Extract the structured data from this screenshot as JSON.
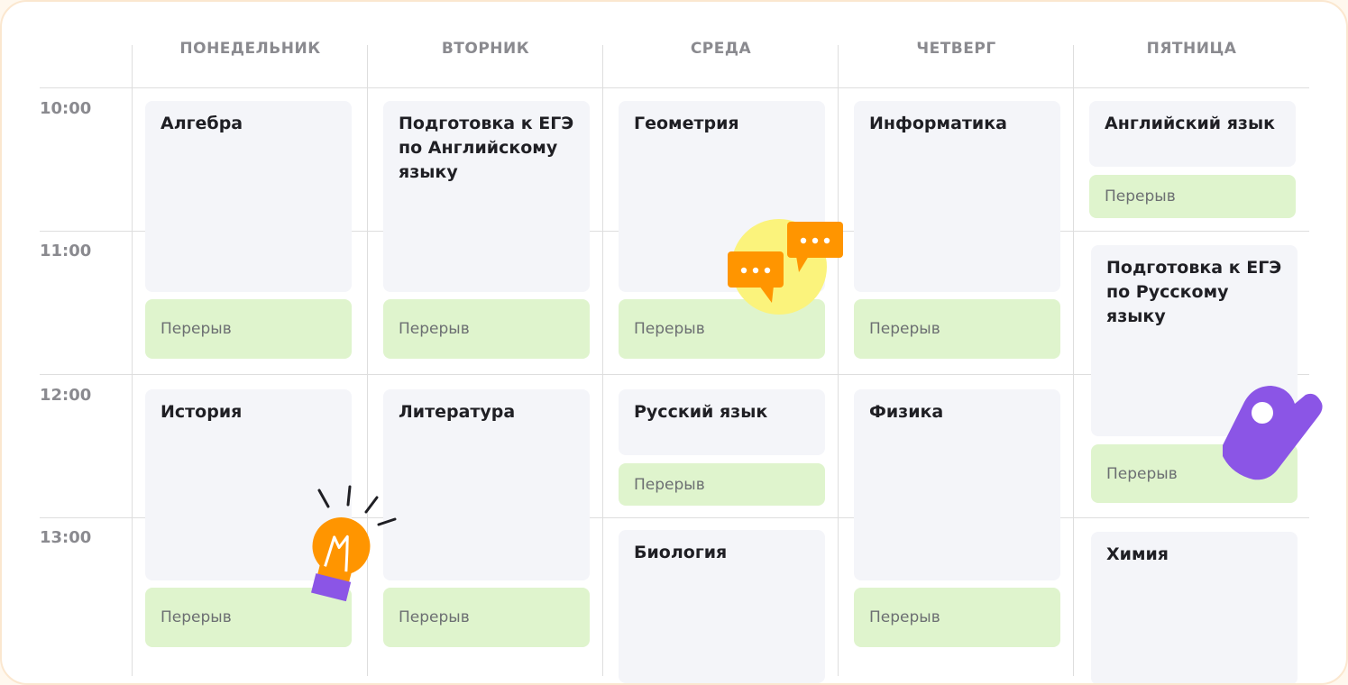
{
  "days": [
    "ПОНЕДЕЛЬНИК",
    "ВТОРНИК",
    "СРЕДА",
    "ЧЕТВЕРГ",
    "ПЯТНИЦА"
  ],
  "times": [
    "10:00",
    "11:00",
    "12:00",
    "13:00"
  ],
  "break_label": "Перерыв",
  "lessons": {
    "mon": [
      "Алгебра",
      "История"
    ],
    "tue": [
      "Подготовка к ЕГЭ по Английскому языку",
      "Литература"
    ],
    "wed": [
      "Геометрия",
      "Русский язык",
      "Биология"
    ],
    "thu": [
      "Информатика",
      "Физика"
    ],
    "fri": [
      "Английский язык",
      "Подготовка к ЕГЭ по Русскому языку",
      "Химия"
    ]
  },
  "icons": {
    "chat": "chat-bubbles-icon",
    "bulb": "lightbulb-icon",
    "ok": "ok-hand-icon"
  },
  "colors": {
    "lesson_bg": "#f4f5f9",
    "break_bg": "#dff4cd",
    "accent_orange": "#ff9500",
    "accent_purple": "#8b55e6",
    "accent_yellow": "#fbf37c"
  }
}
